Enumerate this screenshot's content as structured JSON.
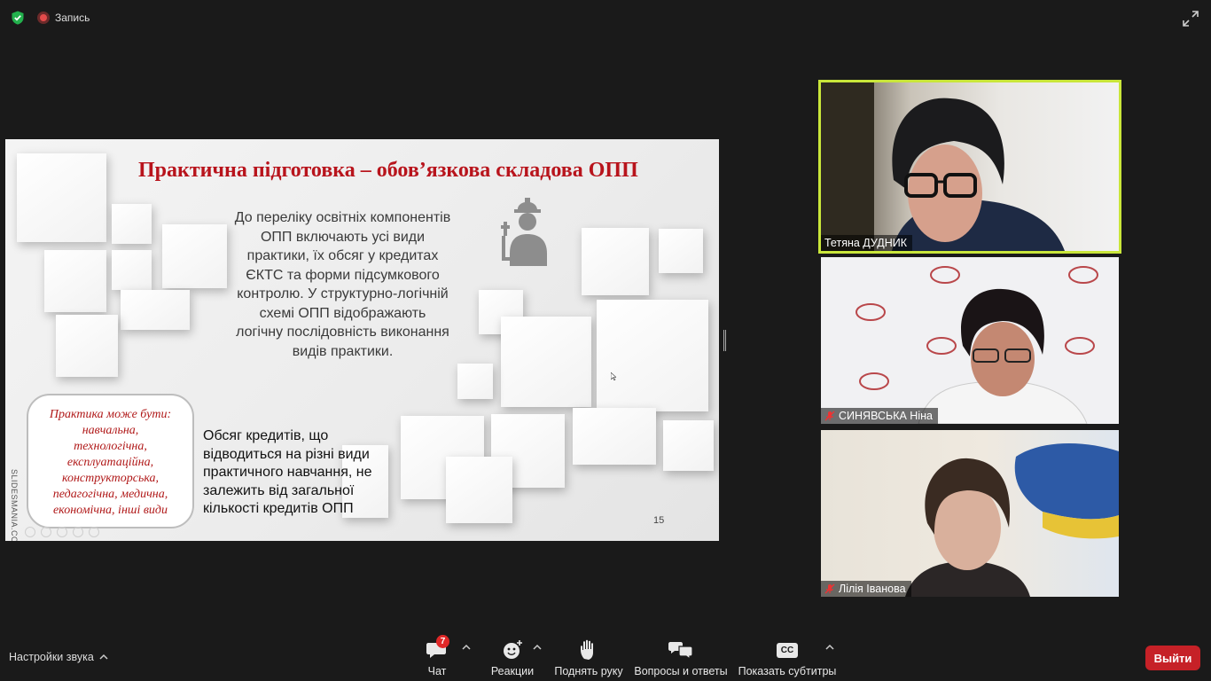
{
  "topbar": {
    "record_label": "Запись"
  },
  "slide": {
    "title": "Практична підготовка – обов’язкова складова ОПП",
    "main_text": "До переліку освітніх компонентів ОПП включають усі види практики, їх обсяг у кредитах ЄКТС та форми підсумкового контролю. У структурно-логічній схемі ОПП відображають логічну послідовність виконання видів практики.",
    "credits_text": "Обсяг кредитів, що відводиться на різні види практичного навчання, не залежить від загальної кількості кредитів ОПП",
    "types_lines": [
      "Практика може бути:",
      "навчальна,",
      "технологічна,",
      "експлуатаційна,",
      "конструкторська,",
      "педагогічна, медична,",
      "економічна, інші види"
    ],
    "side_label": "SLIDESMANIA.COM",
    "page_number": "15",
    "accent_color": "#b8141c",
    "icon": "worker-icon"
  },
  "participants": [
    {
      "name": "Тетяна ДУДНИК",
      "muted": false,
      "active": true
    },
    {
      "name": "СИНЯВСЬКА Ніна",
      "muted": true,
      "active": false
    },
    {
      "name": "Лілія Іванова",
      "muted": true,
      "active": false
    }
  ],
  "toolbar": {
    "audio_settings": "Настройки звука",
    "chat": "Чат",
    "chat_badge": "7",
    "reactions": "Реакции",
    "raise_hand": "Поднять руку",
    "qa": "Вопросы и ответы",
    "subtitles": "Показать субтитры",
    "subtitles_icon_text": "CC",
    "leave": "Выйти"
  },
  "colors": {
    "active_speaker": "#c9e63a",
    "leave_button": "#c62127",
    "badge": "#e02828"
  }
}
